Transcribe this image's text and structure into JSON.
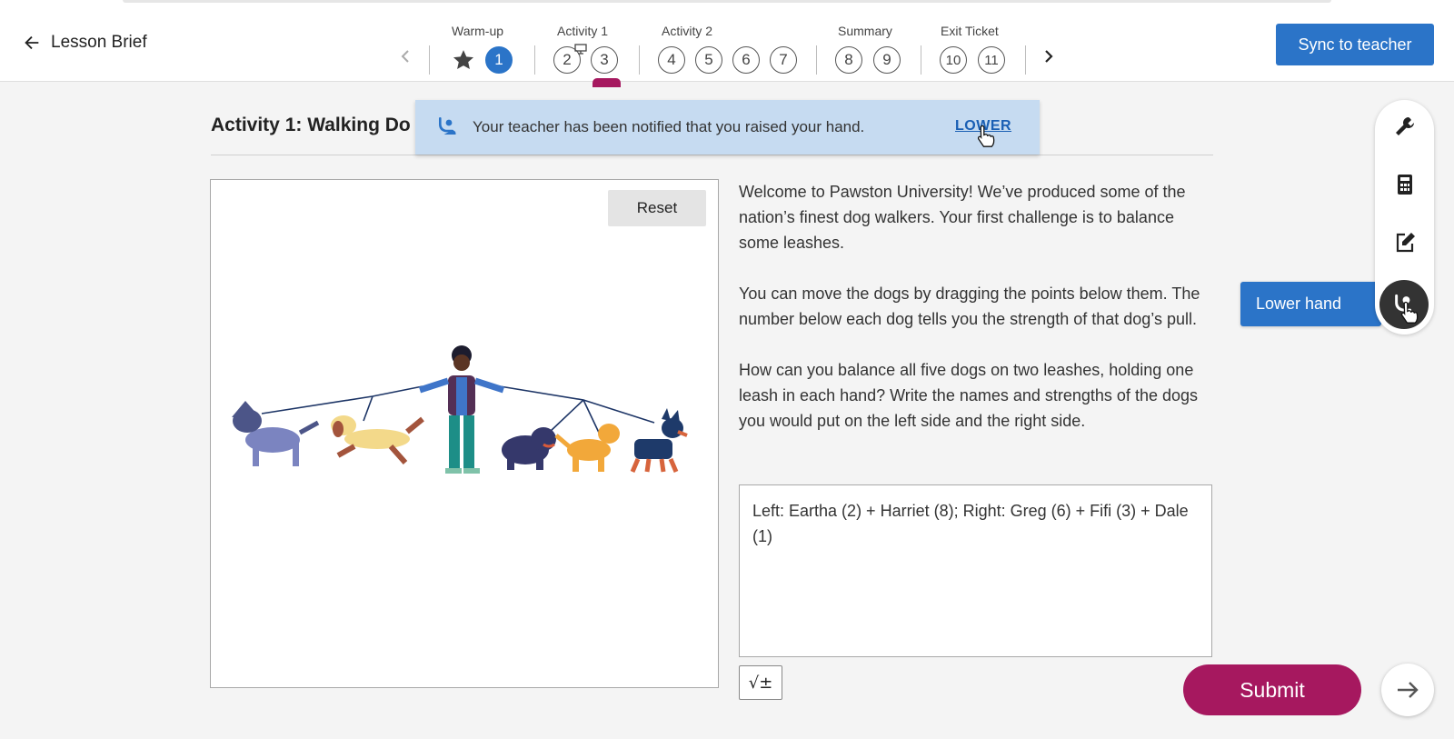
{
  "header": {
    "back_label": "Lesson Brief",
    "sync_label": "Sync to teacher"
  },
  "nav": {
    "groups": [
      {
        "label": "Warm-up"
      },
      {
        "label": "Activity 1"
      },
      {
        "label": "Activity 2"
      },
      {
        "label": "Summary"
      },
      {
        "label": "Exit Ticket"
      }
    ],
    "steps": [
      "1",
      "2",
      "3",
      "4",
      "5",
      "6",
      "7",
      "8",
      "9",
      "10",
      "11"
    ],
    "active_step": "1",
    "current_step": "3"
  },
  "activity": {
    "title": "Activity 1: Walking Do"
  },
  "toast": {
    "message": "Your teacher has been notified that you raised your hand.",
    "action": "LOWER"
  },
  "graph": {
    "reset_label": "Reset"
  },
  "instructions": {
    "p1": "Welcome to Pawston University! We’ve produced some of the nation’s finest dog walkers. Your first challenge is to balance some leashes.",
    "p2": "You can move the dogs by dragging the points below them. The number below each dog tells you the strength of that dog’s pull.",
    "p3": "How can you balance all five dogs on two leashes, holding one leash in each hand? Write the names and strengths of the dogs you would put on the left side and the right side."
  },
  "answer": {
    "value": "Left: Eartha (2) + Harriet (8); Right: Greg (6) + Fifi (3) + Dale (1)",
    "math_label": "√±"
  },
  "footer": {
    "submit_label": "Submit"
  },
  "toolbar": {
    "tools": [
      "wrench-icon",
      "calculator-icon",
      "notepad-icon",
      "raise-hand-icon"
    ],
    "lower_hand_label": "Lower hand"
  },
  "colors": {
    "primary": "#2b74c8",
    "submit": "#a6185f",
    "toast_bg": "#c6dbf1"
  }
}
